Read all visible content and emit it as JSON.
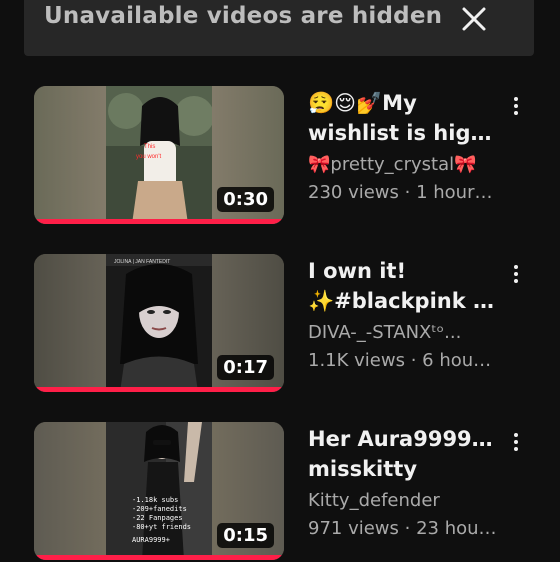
{
  "banner": {
    "text": "Unavailable videos are hidden",
    "close_icon": "close-icon"
  },
  "videos": [
    {
      "title_line1": "😮‍💨😌💅My",
      "title_line2": "wishlist is highe...",
      "channel": "🎀pretty_crystal🎀",
      "meta": "230 views · 1 hour a...",
      "duration": "0:30",
      "progress": 1.0
    },
    {
      "title_line1": "I own it!",
      "title_line2": "✨#blackpink #...",
      "channel": "DIVA-_-STANXᵗᵒ...",
      "meta": "1.1K views · 6 hours ...",
      "duration": "0:17",
      "progress": 1.0
    },
    {
      "title_line1": "Her Aura99999+#",
      "title_line2": "misskitty",
      "channel": "Kitty_defender",
      "meta": "971 views · 23 hours...",
      "duration": "0:15",
      "progress": 1.0,
      "overlay_lines": [
        "-1.18k subs",
        "-209+fanedits",
        "-22 Fanpages",
        "-80+yt friends",
        "AURA9999+"
      ]
    }
  ],
  "colors": {
    "background": "#0f0f0f",
    "progress": "#ff1f48",
    "secondary_text": "#aaaaaa"
  }
}
